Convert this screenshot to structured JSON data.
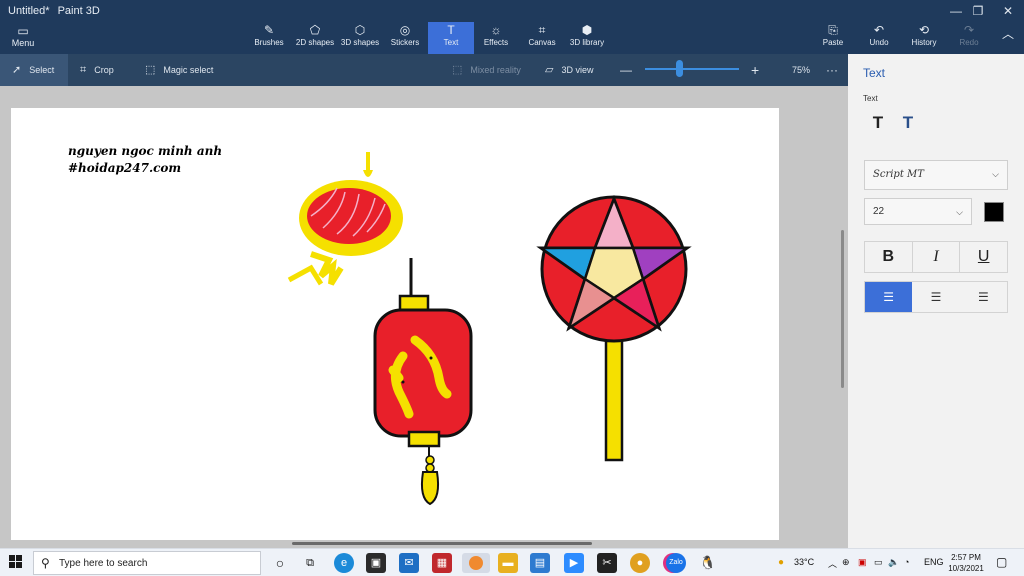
{
  "window": {
    "doc_title": "Untitled*",
    "app_name": "Paint 3D"
  },
  "menu": {
    "label": "Menu"
  },
  "ribbon": [
    {
      "key": "brushes",
      "label": "Brushes",
      "icon": "✎"
    },
    {
      "key": "2d",
      "label": "2D shapes",
      "icon": "⬠"
    },
    {
      "key": "3d",
      "label": "3D shapes",
      "icon": "⬡"
    },
    {
      "key": "stickers",
      "label": "Stickers",
      "icon": "◎"
    },
    {
      "key": "text",
      "label": "Text",
      "icon": "T"
    },
    {
      "key": "effects",
      "label": "Effects",
      "icon": "☼"
    },
    {
      "key": "canvas",
      "label": "Canvas",
      "icon": "⌗"
    },
    {
      "key": "library",
      "label": "3D library",
      "icon": "⬢"
    }
  ],
  "right_ribbon": {
    "paste": "Paste",
    "undo": "Undo",
    "history": "History",
    "redo": "Redo"
  },
  "toolbar": {
    "select": "Select",
    "crop": "Crop",
    "magic": "Magic select",
    "mixed": "Mixed reality",
    "view3d": "3D view",
    "zoom": "75%"
  },
  "canvas": {
    "line1": "nguyen ngoc minh anh",
    "line2": "#hoidap247.com"
  },
  "panel": {
    "title": "Text",
    "sub": "Text",
    "font": "Script MT",
    "size": "22",
    "bold": "B",
    "italic": "I",
    "underline": "U"
  },
  "taskbar": {
    "search_placeholder": "Type here to search",
    "weather": "33°C",
    "lang": "ENG",
    "time": "2:57 PM",
    "date": "10/3/2021"
  },
  "colors": {
    "ribbon": "#1f3a5c",
    "accent": "#3c6fd8",
    "lantern_red": "#e8202a",
    "lantern_yellow": "#f5e000"
  }
}
